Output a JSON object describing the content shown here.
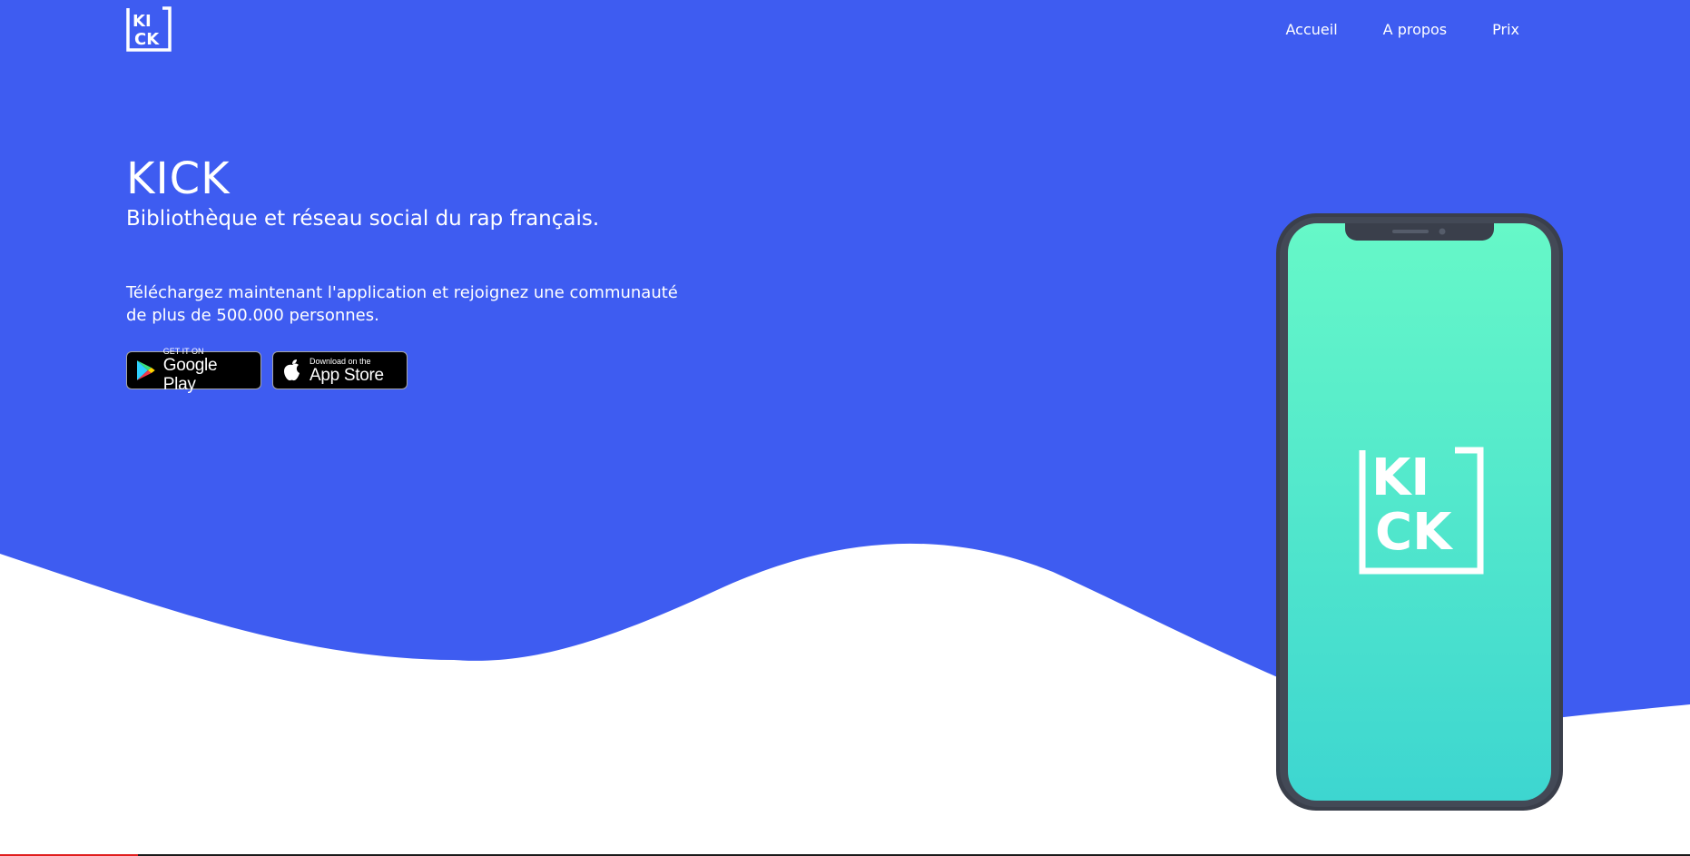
{
  "brand": {
    "logo_line1": "KI",
    "logo_line2": "CK",
    "icon": "kick-logo-icon"
  },
  "nav": {
    "items": [
      {
        "label": "Accueil"
      },
      {
        "label": "A propos"
      },
      {
        "label": "Prix"
      }
    ]
  },
  "hero": {
    "title": "KICK",
    "subtitle": "Bibliothèque et réseau social du rap français.",
    "description": "Téléchargez maintenant l'application et rejoignez une communauté de plus de 500.000 personnes."
  },
  "badges": {
    "google": {
      "small": "GET IT ON",
      "big": "Google Play",
      "icon": "google-play-icon"
    },
    "apple": {
      "small": "Download on the",
      "big": "App Store",
      "icon": "apple-icon"
    }
  },
  "phone": {
    "screen_logo_line1": "KI",
    "screen_logo_line2": "CK"
  },
  "colors": {
    "primary_blue": "#3e5cf1",
    "phone_frame": "#3a3f4b",
    "screen_top": "#66f8c8",
    "screen_bottom": "#3dd6d0",
    "white": "#ffffff"
  }
}
